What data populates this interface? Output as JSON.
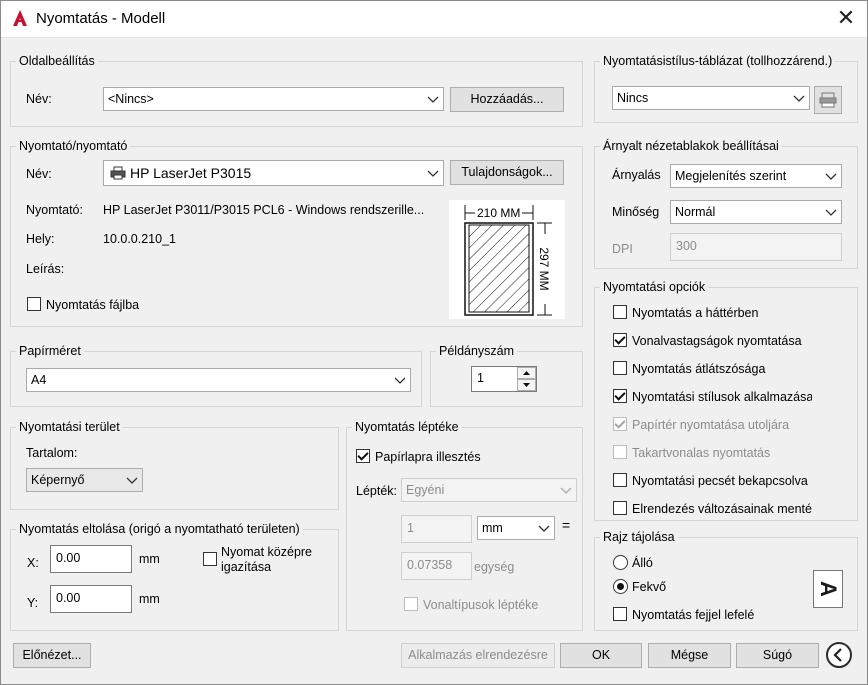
{
  "window": {
    "title": "Nyomtatás - Modell",
    "close_label": "✕"
  },
  "page_setup": {
    "label": "Oldalbeállítás",
    "name_label": "Név:",
    "name_value": "<Nincs>",
    "add_button": "Hozzáadás..."
  },
  "printer": {
    "label": "Nyomtató/nyomtató",
    "name_label": "Név:",
    "name_value": "HP LaserJet P3015",
    "properties_button": "Tulajdonságok...",
    "plotter_label": "Nyomtató:",
    "plotter_value": "HP LaserJet P3011/P3015 PCL6 - Windows rendszerille...",
    "where_label": "Hely:",
    "where_value": "10.0.0.210_1",
    "description_label": "Leírás:",
    "plot_to_file": "Nyomtatás fájlba",
    "preview_width": "210 MM",
    "preview_height": "297 MM"
  },
  "paper_size": {
    "label": "Papírméret",
    "value": "A4"
  },
  "copies": {
    "label": "Példányszám",
    "value": "1"
  },
  "plot_area": {
    "label": "Nyomtatási terület",
    "what_label": "Tartalom:",
    "what_value": "Képernyő"
  },
  "plot_offset": {
    "label": "Nyomtatás eltolása (origó a nyomtatható területen)",
    "x_label": "X:",
    "x_value": "0.00",
    "x_unit": "mm",
    "y_label": "Y:",
    "y_value": "0.00",
    "y_unit": "mm",
    "center_line1": "Nyomat középre",
    "center_line2": "igazítása"
  },
  "plot_scale": {
    "label": "Nyomtatás léptéke",
    "fit_to_paper": "Papírlapra illesztés",
    "scale_label": "Lépték:",
    "scale_value": "Egyéni",
    "value1": "1",
    "unit_value": "mm",
    "equals": "=",
    "value2": "0.07358",
    "unit2": "egység",
    "scale_lineweights": "Vonaltípusok léptéke"
  },
  "plot_style_table": {
    "label": "Nyomtatásistílus-táblázat (tollhozzárend.)",
    "value": "Nincs"
  },
  "shaded_viewport": {
    "label": "Árnyalt nézetablakok beállításai",
    "shade_label": "Árnyalás",
    "shade_value": "Megjelenítés szerint",
    "quality_label": "Minőség",
    "quality_value": "Normál",
    "dpi_label": "DPI",
    "dpi_value": "300"
  },
  "plot_options": {
    "label": "Nyomtatási opciók",
    "items": [
      {
        "label": "Nyomtatás a háttérben",
        "checked": false,
        "disabled": false
      },
      {
        "label": "Vonalvastagságok nyomtatása",
        "checked": true,
        "disabled": false
      },
      {
        "label": "Nyomtatás átlátszósága",
        "checked": false,
        "disabled": false
      },
      {
        "label": "Nyomtatási stílusok alkalmazása",
        "checked": true,
        "disabled": false
      },
      {
        "label": "Papírtér nyomtatása utoljára",
        "checked": true,
        "disabled": true
      },
      {
        "label": "Takartvonalas nyomtatás",
        "checked": false,
        "disabled": true
      },
      {
        "label": "Nyomtatási pecsét bekapcsolva",
        "checked": false,
        "disabled": false
      },
      {
        "label": "Elrendezés változásainak mentése",
        "checked": false,
        "disabled": false
      }
    ]
  },
  "orientation": {
    "label": "Rajz tájolása",
    "portrait": "Álló",
    "landscape": "Fekvő",
    "upside_down": "Nyomtatás fejjel lefelé",
    "icon_letter": "A"
  },
  "footer": {
    "preview": "Előnézet...",
    "apply_layout": "Alkalmazás elrendezésre",
    "ok": "OK",
    "cancel": "Mégse",
    "help": "Súgó"
  }
}
